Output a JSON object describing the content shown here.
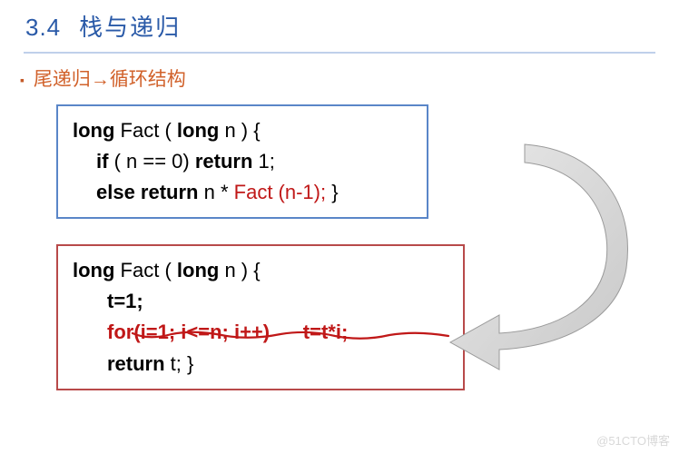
{
  "heading": {
    "num": "3.4",
    "title": "栈与递归"
  },
  "subtitle": {
    "left": "尾递归",
    "arrow": "→",
    "right": "循环结构"
  },
  "code1": {
    "l1a": "long",
    "l1b": " Fact ( ",
    "l1c": "long",
    "l1d": " n ) {",
    "l2a": "if",
    "l2b": " ( n  == 0) ",
    "l2c": "return",
    "l2d": " 1;",
    "l3a": "else return",
    "l3b": " n * ",
    "l3c": "Fact (n-1);",
    "l3d": " }"
  },
  "code2": {
    "l1a": "long",
    "l1b": " Fact ( ",
    "l1c": "long",
    "l1d": " n ) {",
    "l2": "t=1;",
    "l3a": "for(i=1; i<=n; i++)",
    "l3b": "      t=t*i;",
    "l4a": "return",
    "l4b": " t; }"
  },
  "watermark": "@51CTO博客"
}
